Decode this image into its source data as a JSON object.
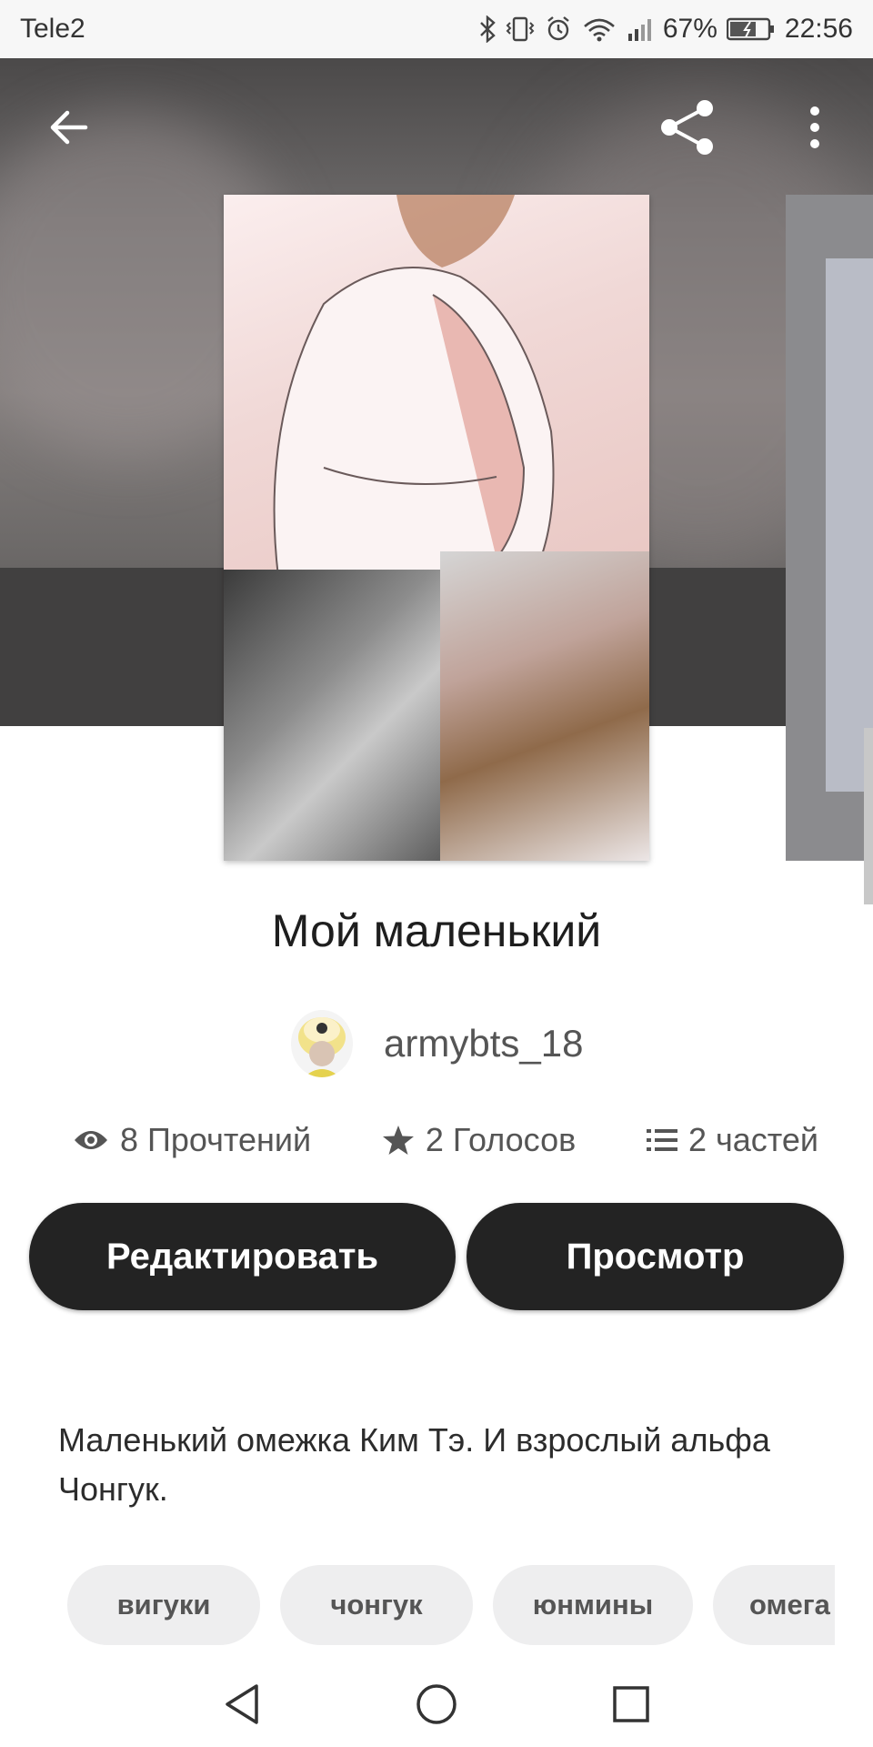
{
  "status_bar": {
    "carrier": "Tele2",
    "battery": "67%",
    "time": "22:56"
  },
  "header": {
    "back_icon": "arrow-left-icon",
    "share_icon": "share-icon",
    "more_icon": "more-vertical-icon"
  },
  "story": {
    "title": "Мой маленький",
    "author": "armybts_18",
    "stats": {
      "reads": "8 Прочтений",
      "votes": "2 Голосов",
      "parts": "2 частей"
    },
    "buttons": {
      "edit": "Редактировать",
      "preview": "Просмотр"
    },
    "description": "Маленький омежка Ким Тэ. И взрослый альфа Чонгук.",
    "tags": [
      "вигуки",
      "чонгук",
      "юнмины",
      "омега"
    ]
  },
  "colors": {
    "button_bg": "#232323",
    "tag_bg": "#eeeeef",
    "hero_bg": "#6e6b6b"
  }
}
